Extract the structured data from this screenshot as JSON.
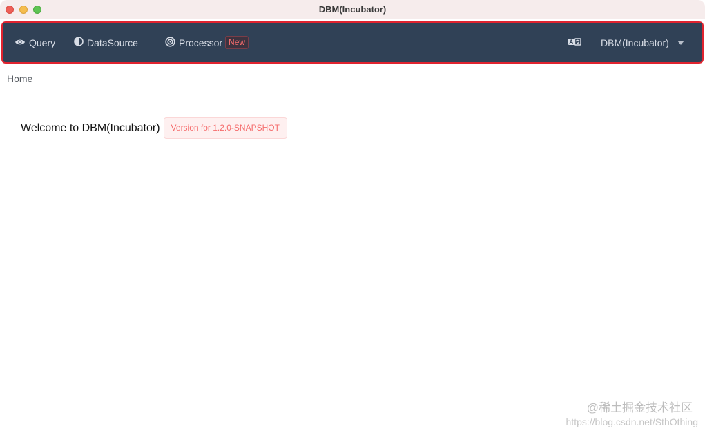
{
  "window": {
    "title": "DBM(Incubator)"
  },
  "navbar": {
    "items": [
      {
        "label": "Query",
        "icon": "eye-icon"
      },
      {
        "label": "DataSource",
        "icon": "half-circle-icon"
      },
      {
        "label": "Processor",
        "icon": "target-icon",
        "badge": "New"
      }
    ],
    "language_icon": "translate-icon",
    "instance_select": {
      "value": "DBM(Incubator)"
    },
    "highlight_color": "#e0232f",
    "background_color": "#304156"
  },
  "breadcrumb": {
    "home": "Home"
  },
  "main": {
    "welcome_text": "Welcome to DBM(Incubator)",
    "version_tag": "Version for 1.2.0-SNAPSHOT"
  },
  "watermark": {
    "brand": "@稀土掘金技术社区",
    "url": "https://blog.csdn.net/SthOthing"
  }
}
